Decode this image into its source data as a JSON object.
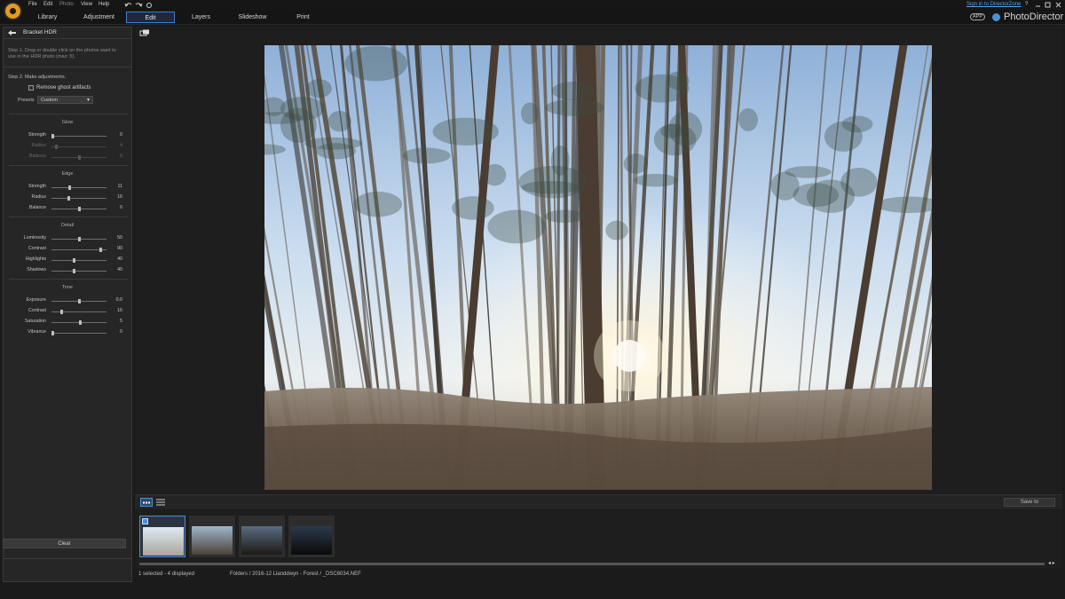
{
  "menubar": {
    "items": [
      "File",
      "Edit",
      "Photo",
      "View",
      "Help"
    ],
    "sign_in": "Sign in to DirectorZone",
    "help": "?",
    "app_badge": "APP",
    "brand": "PhotoDirector"
  },
  "tabs": [
    "Library",
    "Adjustment",
    "Edit",
    "Layers",
    "Slideshow",
    "Print"
  ],
  "active_tab": "Edit",
  "panel": {
    "title": "Bracket HDR",
    "step1": "Step 1. Drag or double click on the photos  want to use in the HDR photo (max: 5).",
    "step2": "Step 2. Make adjustments.",
    "ghost_label": "Remove ghost artifacts",
    "presets_label": "Presets",
    "presets_value": "Custom",
    "clear_label": "Clear",
    "sections": [
      {
        "title": "Glow",
        "sliders": [
          {
            "label": "Strength",
            "value": "0",
            "pos": 0.02,
            "dim": false
          },
          {
            "label": "Radius",
            "value": "4",
            "pos": 0.08,
            "dim": true
          },
          {
            "label": "Balance",
            "value": "0",
            "pos": 0.5,
            "dim": true
          }
        ]
      },
      {
        "title": "Edge",
        "sliders": [
          {
            "label": "Strength",
            "value": "11",
            "pos": 0.32,
            "dim": false
          },
          {
            "label": "Radius",
            "value": "16",
            "pos": 0.3,
            "dim": false
          },
          {
            "label": "Balance",
            "value": "0",
            "pos": 0.5,
            "dim": false
          }
        ]
      },
      {
        "title": "Detail",
        "sliders": [
          {
            "label": "Luminosity",
            "value": "50",
            "pos": 0.5,
            "dim": false
          },
          {
            "label": "Contrast",
            "value": "90",
            "pos": 0.88,
            "dim": false
          },
          {
            "label": "Highlights",
            "value": "40",
            "pos": 0.4,
            "dim": false
          },
          {
            "label": "Shadows",
            "value": "40",
            "pos": 0.4,
            "dim": false
          }
        ]
      },
      {
        "title": "Tone",
        "sliders": [
          {
            "label": "Exposure",
            "value": "0.0",
            "pos": 0.5,
            "dim": false
          },
          {
            "label": "Contrast",
            "value": "16",
            "pos": 0.18,
            "dim": false
          },
          {
            "label": "Saturation",
            "value": "5",
            "pos": 0.52,
            "dim": false
          },
          {
            "label": "Vibrance",
            "value": "0",
            "pos": 0.02,
            "dim": false
          }
        ]
      }
    ]
  },
  "film": {
    "save_label": "Save to",
    "thumbnails": [
      "bright exposure",
      "normal exposure",
      "dark exposure",
      "darkest exposure"
    ]
  },
  "status": {
    "count": "1 selected - 4 displayed",
    "path": "Folders / 2016-12 Llanddwyn - Forest / _DSC6034.NEF"
  },
  "colors": {
    "accent": "#4a90d9",
    "logo": "#e69b1e"
  }
}
